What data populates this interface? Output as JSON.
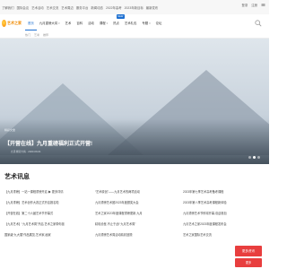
{
  "topbar": {
    "links": [
      "了解我们",
      "国际会议",
      "艺术活动",
      "艺术交流",
      "艺术周边",
      "服务平台",
      "新闻动态",
      "2022年高考",
      "2023年新目标",
      "最新发布"
    ],
    "login": "登录",
    "register": "注册",
    "right_icon": "menu-icon"
  },
  "logo": {
    "text": "艺术之家"
  },
  "nav": {
    "items": [
      {
        "label": "首页",
        "active": true
      },
      {
        "label": "九月重磅大将",
        "active": false,
        "chevron": true
      },
      {
        "label": "艺术",
        "active": false
      },
      {
        "label": "百科",
        "active": false
      },
      {
        "label": "活动",
        "active": false
      },
      {
        "label": "课程",
        "active": false,
        "chevron": true
      },
      {
        "label": "热点",
        "active": false,
        "badge": "NEW"
      },
      {
        "label": "艺术礼包",
        "active": false
      },
      {
        "label": "专题",
        "active": false,
        "chevron": true
      },
      {
        "label": "论坛",
        "active": false
      }
    ],
    "subnav": [
      "热门",
      "艺考",
      "推荐"
    ]
  },
  "hero": {
    "tag": "精彩文章",
    "title": "【开营在线】九月重磅福利正式开营!",
    "meta": "九月重磅大将 · 2023-09-01",
    "dots": 3,
    "active_dot": 1
  },
  "section": {
    "title": "艺术讯息"
  },
  "columns": [
    [
      "【九月重磅】一站一课程重磅开启 ▶ 更多详情",
      "【九月重磅】艺术创作大赛正式开启报名啦",
      "【开营在线】第二十六届艺术节开幕式",
      "【九月艺术】“九月艺术周”开启,艺术之家带你逛",
      "国家级“九大展”作品展览,艺术家,画家"
    ],
    [
      "“艺术原创”——九月艺术的两项活动",
      "九月重磅艺术团2023年度颁奖大会",
      "艺术之家2023年度课程重磅更新,九月",
      "精彩纷呈,不止于此!“九月艺术周”",
      "九月重磅艺术周活动精彩回顾"
    ],
    [
      "2023年第七季艺术高考备考课程",
      "2023年第八季艺术高考课程新体验",
      "九月重磅艺术节即将开幕,欢迎参加",
      "九月艺术之家2023年度课程发布会",
      "艺术之家国际艺术交流"
    ]
  ],
  "pager": {
    "primary_label": "更多资讯",
    "secondary_label": "更多"
  }
}
